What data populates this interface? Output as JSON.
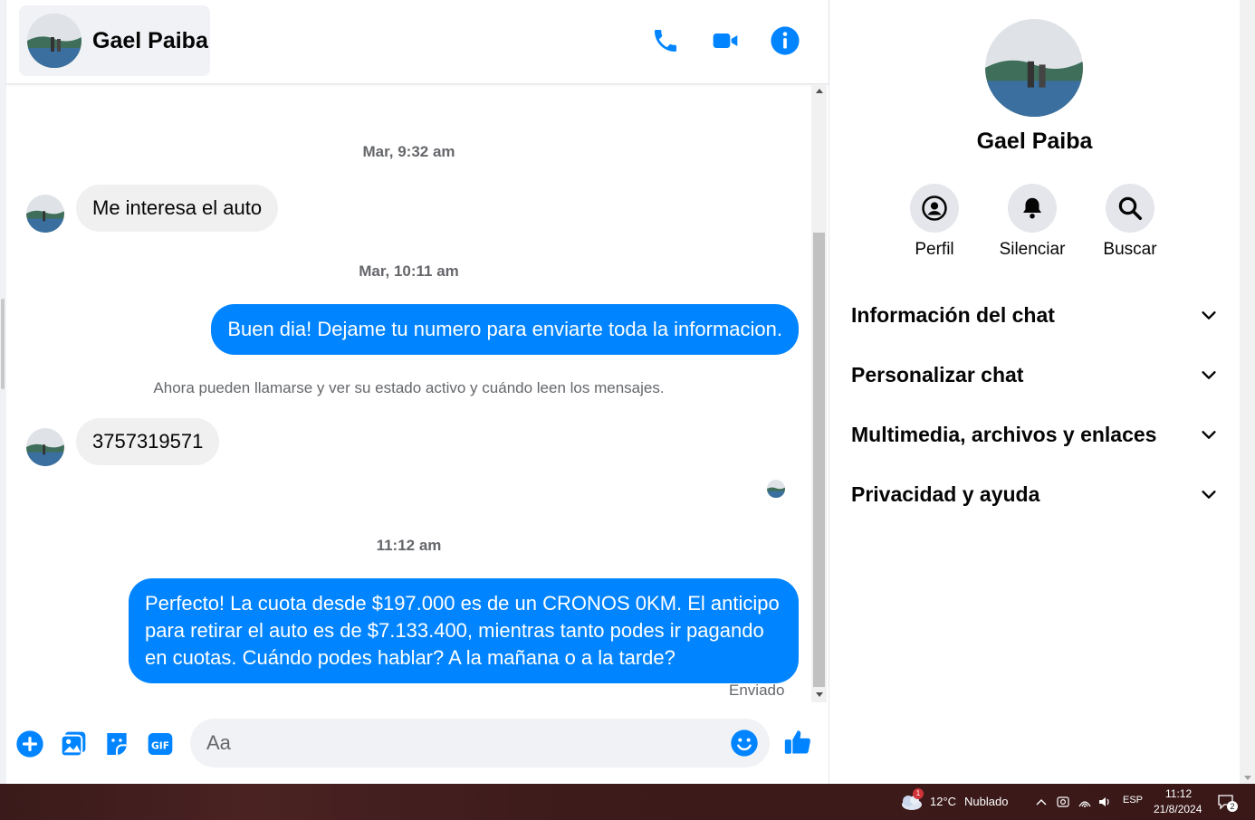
{
  "contact": {
    "name": "Gael Paiba"
  },
  "header": {
    "icons": [
      "phone-icon",
      "video-icon",
      "info-icon"
    ]
  },
  "accent_color": "#0084ff",
  "messages": [
    {
      "type": "timestamp",
      "text": "Mar, 9:32 am"
    },
    {
      "type": "incoming",
      "text": "Me interesa el auto"
    },
    {
      "type": "timestamp",
      "text": "Mar, 10:11 am"
    },
    {
      "type": "outgoing",
      "text": "Buen dia! Dejame tu numero para enviarte toda la informacion."
    },
    {
      "type": "notice",
      "text": "Ahora pueden llamarse y ver su estado activo y cuándo leen los mensajes."
    },
    {
      "type": "incoming",
      "text": "3757319571"
    },
    {
      "type": "timestamp",
      "text": "11:12 am"
    },
    {
      "type": "outgoing",
      "text": "Perfecto! La cuota desde $197.000 es de un CRONOS 0KM. El anticipo para retirar el auto es de $7.133.400, mientras tanto podes ir pagando en cuotas. Cuándo podes hablar? A la mañana o a la tarde?"
    }
  ],
  "message_status": "Enviado",
  "composer": {
    "placeholder": "Aa",
    "icons": [
      "plus-icon",
      "image-icon",
      "sticker-icon",
      "gif-icon",
      "emoji-icon",
      "thumbs-up-icon"
    ],
    "gif_label": "GIF"
  },
  "info_panel": {
    "actions": [
      {
        "label": "Perfil",
        "icon": "profile-icon"
      },
      {
        "label": "Silenciar",
        "icon": "bell-icon"
      },
      {
        "label": "Buscar",
        "icon": "search-icon"
      }
    ],
    "sections": [
      "Información del chat",
      "Personalizar chat",
      "Multimedia, archivos y enlaces",
      "Privacidad y ayuda"
    ]
  },
  "taskbar": {
    "weather": {
      "temp": "12°C",
      "condition": "Nublado",
      "badge": "1"
    },
    "language": "ESP",
    "time": "11:12",
    "date": "21/8/2024",
    "notifications": "2"
  }
}
